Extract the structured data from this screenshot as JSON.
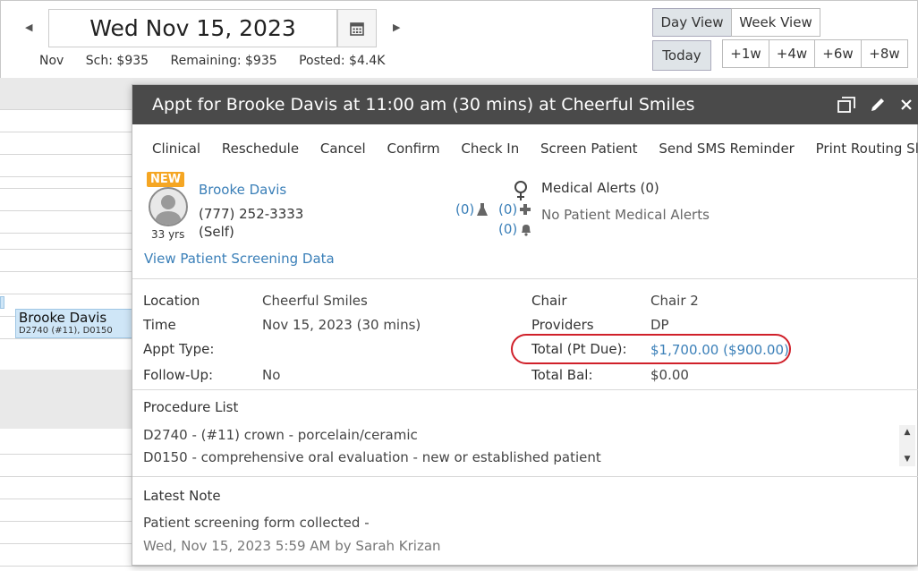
{
  "header": {
    "date": "Wed Nov 15, 2023",
    "stats": {
      "month": "Nov",
      "scheduled": "Sch: $935",
      "remaining": "Remaining: $935",
      "posted": "Posted: $4.4K"
    },
    "views": {
      "day": "Day View",
      "week": "Week View"
    },
    "today": "Today",
    "jumps": [
      "+1w",
      "+4w",
      "+6w",
      "+8w"
    ]
  },
  "schedule": {
    "chip": {
      "name": "Brooke Davis",
      "codes": "D2740 (#11), D0150"
    }
  },
  "popup": {
    "title": "Appt for Brooke Davis at 11:00 am (30 mins) at Cheerful Smiles",
    "actions": [
      "Clinical",
      "Reschedule",
      "Cancel",
      "Confirm",
      "Check In",
      "Screen Patient",
      "Send SMS Reminder",
      "Print Routing Slip"
    ],
    "patient": {
      "badge": "NEW",
      "age": "33 yrs",
      "name": "Brooke Davis",
      "phone": "(777) 252-3333",
      "relation": "(Self)",
      "screening_link": "View Patient Screening Data"
    },
    "counts": {
      "lab": "(0)",
      "med": "(0)",
      "alert": "(0)"
    },
    "medical": {
      "title": "Medical Alerts (0)",
      "sub": "No Patient Medical Alerts"
    },
    "details": {
      "location_label": "Location",
      "location": "Cheerful Smiles",
      "time_label": "Time",
      "time": "Nov 15, 2023 (30 mins)",
      "appt_type_label": "Appt Type:",
      "appt_type": "",
      "followup_label": "Follow-Up:",
      "followup": "No",
      "chair_label": "Chair",
      "chair": "Chair 2",
      "providers_label": "Providers",
      "providers": "DP",
      "total_label": "Total (Pt Due):",
      "total": "$1,700.00 ($900.00)",
      "bal_label": "Total Bal:",
      "bal": "$0.00"
    },
    "procedures": {
      "title": "Procedure List",
      "items": [
        "D2740 - (#11) crown - porcelain/ceramic",
        "D0150 - comprehensive oral evaluation - new or established patient"
      ]
    },
    "note": {
      "title": "Latest Note",
      "body": "Patient screening form collected -",
      "meta": "Wed, Nov 15, 2023 5:59 AM by Sarah Krizan"
    }
  },
  "colors": {
    "title_bar": "#4a4a4a",
    "link": "#3a7fb8",
    "highlight": "#d0202a",
    "badge": "#f5a623",
    "chip": "#cfe6f7"
  }
}
